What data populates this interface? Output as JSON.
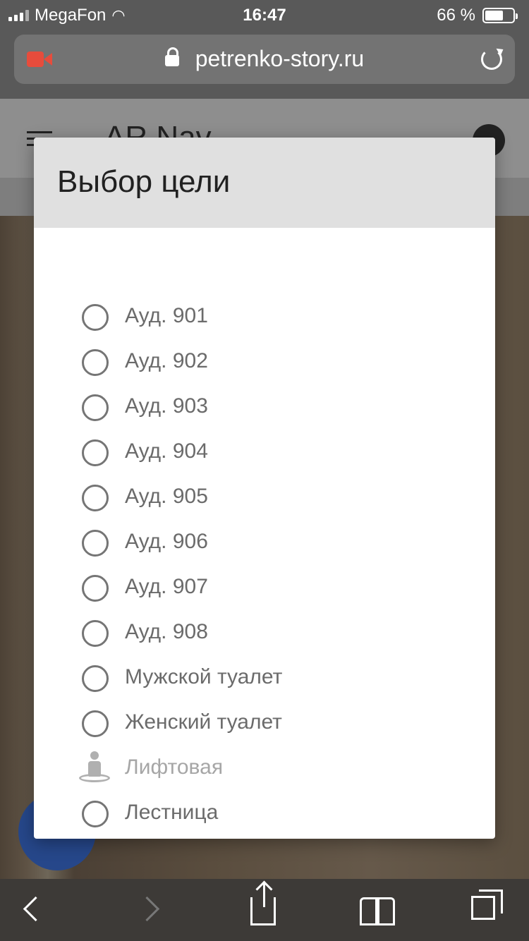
{
  "status_bar": {
    "carrier": "MegaFon",
    "time": "16:47",
    "battery": "66 %",
    "battery_level": 0.66
  },
  "browser": {
    "url": "petrenko-story.ru"
  },
  "app": {
    "title": "AR Nav"
  },
  "dialog": {
    "title": "Выбор цели",
    "options": [
      {
        "label": "Ауд. 901",
        "icon": "radio"
      },
      {
        "label": "Ауд. 902",
        "icon": "radio"
      },
      {
        "label": "Ауд. 903",
        "icon": "radio"
      },
      {
        "label": "Ауд. 904",
        "icon": "radio"
      },
      {
        "label": "Ауд. 905",
        "icon": "radio"
      },
      {
        "label": "Ауд. 906",
        "icon": "radio"
      },
      {
        "label": "Ауд. 907",
        "icon": "radio"
      },
      {
        "label": "Ауд. 908",
        "icon": "radio"
      },
      {
        "label": "Мужской туалет",
        "icon": "radio"
      },
      {
        "label": "Женский туалет",
        "icon": "radio"
      },
      {
        "label": "Лифтовая",
        "icon": "person-location-icon",
        "state": "disabled"
      },
      {
        "label": "Лестница",
        "icon": "radio"
      }
    ]
  },
  "colors": {
    "accent": "#26478a",
    "record": "#e74c3c"
  }
}
